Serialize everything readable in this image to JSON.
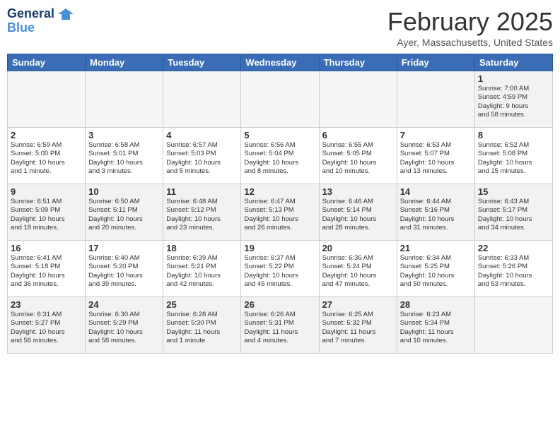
{
  "header": {
    "logo_line1": "General",
    "logo_line2": "Blue",
    "month_title": "February 2025",
    "location": "Ayer, Massachusetts, United States"
  },
  "weekdays": [
    "Sunday",
    "Monday",
    "Tuesday",
    "Wednesday",
    "Thursday",
    "Friday",
    "Saturday"
  ],
  "weeks": [
    [
      {
        "day": "",
        "info": ""
      },
      {
        "day": "",
        "info": ""
      },
      {
        "day": "",
        "info": ""
      },
      {
        "day": "",
        "info": ""
      },
      {
        "day": "",
        "info": ""
      },
      {
        "day": "",
        "info": ""
      },
      {
        "day": "1",
        "info": "Sunrise: 7:00 AM\nSunset: 4:59 PM\nDaylight: 9 hours\nand 58 minutes."
      }
    ],
    [
      {
        "day": "2",
        "info": "Sunrise: 6:59 AM\nSunset: 5:00 PM\nDaylight: 10 hours\nand 1 minute."
      },
      {
        "day": "3",
        "info": "Sunrise: 6:58 AM\nSunset: 5:01 PM\nDaylight: 10 hours\nand 3 minutes."
      },
      {
        "day": "4",
        "info": "Sunrise: 6:57 AM\nSunset: 5:03 PM\nDaylight: 10 hours\nand 5 minutes."
      },
      {
        "day": "5",
        "info": "Sunrise: 6:56 AM\nSunset: 5:04 PM\nDaylight: 10 hours\nand 8 minutes."
      },
      {
        "day": "6",
        "info": "Sunrise: 6:55 AM\nSunset: 5:05 PM\nDaylight: 10 hours\nand 10 minutes."
      },
      {
        "day": "7",
        "info": "Sunrise: 6:53 AM\nSunset: 5:07 PM\nDaylight: 10 hours\nand 13 minutes."
      },
      {
        "day": "8",
        "info": "Sunrise: 6:52 AM\nSunset: 5:08 PM\nDaylight: 10 hours\nand 15 minutes."
      }
    ],
    [
      {
        "day": "9",
        "info": "Sunrise: 6:51 AM\nSunset: 5:09 PM\nDaylight: 10 hours\nand 18 minutes."
      },
      {
        "day": "10",
        "info": "Sunrise: 6:50 AM\nSunset: 5:11 PM\nDaylight: 10 hours\nand 20 minutes."
      },
      {
        "day": "11",
        "info": "Sunrise: 6:48 AM\nSunset: 5:12 PM\nDaylight: 10 hours\nand 23 minutes."
      },
      {
        "day": "12",
        "info": "Sunrise: 6:47 AM\nSunset: 5:13 PM\nDaylight: 10 hours\nand 26 minutes."
      },
      {
        "day": "13",
        "info": "Sunrise: 6:46 AM\nSunset: 5:14 PM\nDaylight: 10 hours\nand 28 minutes."
      },
      {
        "day": "14",
        "info": "Sunrise: 6:44 AM\nSunset: 5:16 PM\nDaylight: 10 hours\nand 31 minutes."
      },
      {
        "day": "15",
        "info": "Sunrise: 6:43 AM\nSunset: 5:17 PM\nDaylight: 10 hours\nand 34 minutes."
      }
    ],
    [
      {
        "day": "16",
        "info": "Sunrise: 6:41 AM\nSunset: 5:18 PM\nDaylight: 10 hours\nand 36 minutes."
      },
      {
        "day": "17",
        "info": "Sunrise: 6:40 AM\nSunset: 5:20 PM\nDaylight: 10 hours\nand 39 minutes."
      },
      {
        "day": "18",
        "info": "Sunrise: 6:39 AM\nSunset: 5:21 PM\nDaylight: 10 hours\nand 42 minutes."
      },
      {
        "day": "19",
        "info": "Sunrise: 6:37 AM\nSunset: 5:22 PM\nDaylight: 10 hours\nand 45 minutes."
      },
      {
        "day": "20",
        "info": "Sunrise: 6:36 AM\nSunset: 5:24 PM\nDaylight: 10 hours\nand 47 minutes."
      },
      {
        "day": "21",
        "info": "Sunrise: 6:34 AM\nSunset: 5:25 PM\nDaylight: 10 hours\nand 50 minutes."
      },
      {
        "day": "22",
        "info": "Sunrise: 6:33 AM\nSunset: 5:26 PM\nDaylight: 10 hours\nand 53 minutes."
      }
    ],
    [
      {
        "day": "23",
        "info": "Sunrise: 6:31 AM\nSunset: 5:27 PM\nDaylight: 10 hours\nand 56 minutes."
      },
      {
        "day": "24",
        "info": "Sunrise: 6:30 AM\nSunset: 5:29 PM\nDaylight: 10 hours\nand 58 minutes."
      },
      {
        "day": "25",
        "info": "Sunrise: 6:28 AM\nSunset: 5:30 PM\nDaylight: 11 hours\nand 1 minute."
      },
      {
        "day": "26",
        "info": "Sunrise: 6:26 AM\nSunset: 5:31 PM\nDaylight: 11 hours\nand 4 minutes."
      },
      {
        "day": "27",
        "info": "Sunrise: 6:25 AM\nSunset: 5:32 PM\nDaylight: 11 hours\nand 7 minutes."
      },
      {
        "day": "28",
        "info": "Sunrise: 6:23 AM\nSunset: 5:34 PM\nDaylight: 11 hours\nand 10 minutes."
      },
      {
        "day": "",
        "info": ""
      }
    ]
  ]
}
